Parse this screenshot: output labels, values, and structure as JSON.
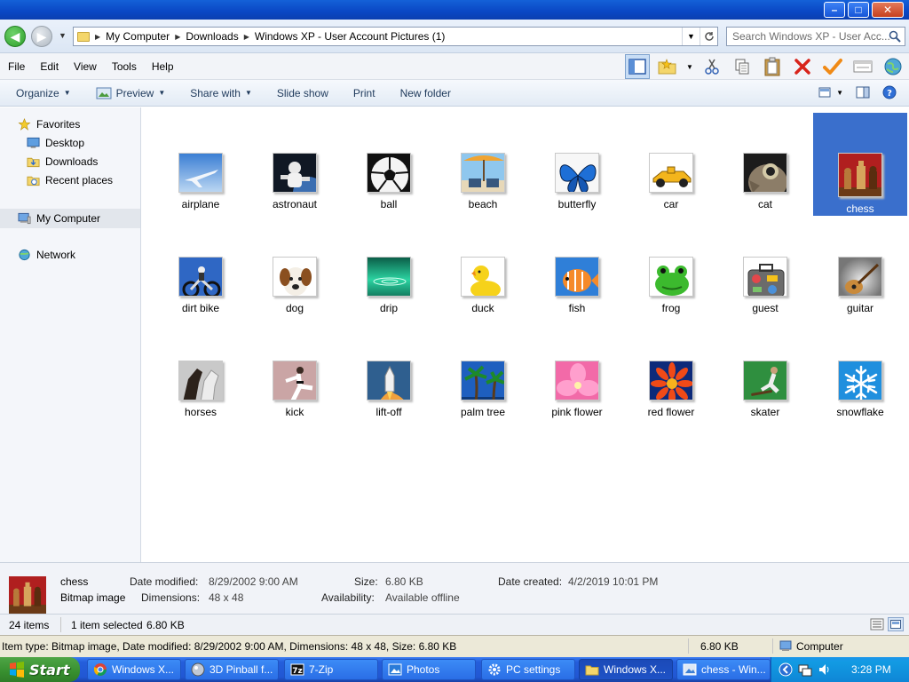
{
  "window": {
    "min": "–",
    "max": "□",
    "close": "✕"
  },
  "address": {
    "crumbs": [
      "My Computer",
      "Downloads",
      "Windows XP - User Account Pictures (1)"
    ],
    "search_placeholder": "Search Windows XP - User Acc..."
  },
  "menu": [
    "File",
    "Edit",
    "View",
    "Tools",
    "Help"
  ],
  "commands": {
    "organize": "Organize",
    "preview": "Preview",
    "share": "Share with",
    "slideshow": "Slide show",
    "print": "Print",
    "newfolder": "New folder"
  },
  "nav": {
    "favorites": "Favorites",
    "desktop": "Desktop",
    "downloads": "Downloads",
    "recent": "Recent places",
    "computer": "My Computer",
    "network": "Network"
  },
  "files": [
    {
      "name": "airplane"
    },
    {
      "name": "astronaut"
    },
    {
      "name": "ball"
    },
    {
      "name": "beach"
    },
    {
      "name": "butterfly"
    },
    {
      "name": "car"
    },
    {
      "name": "cat"
    },
    {
      "name": "chess"
    },
    {
      "name": "dirt bike"
    },
    {
      "name": "dog"
    },
    {
      "name": "drip"
    },
    {
      "name": "duck"
    },
    {
      "name": "fish"
    },
    {
      "name": "frog"
    },
    {
      "name": "guest"
    },
    {
      "name": "guitar"
    },
    {
      "name": "horses"
    },
    {
      "name": "kick"
    },
    {
      "name": "lift-off"
    },
    {
      "name": "palm tree"
    },
    {
      "name": "pink flower"
    },
    {
      "name": "red flower"
    },
    {
      "name": "skater"
    },
    {
      "name": "snowflake"
    }
  ],
  "selected_file": "chess",
  "details": {
    "name": "chess",
    "type": "Bitmap image",
    "date_modified_label": "Date modified:",
    "date_modified": "8/29/2002 9:00 AM",
    "dimensions_label": "Dimensions:",
    "dimensions": "48 x 48",
    "size_label": "Size:",
    "size": "6.80 KB",
    "availability_label": "Availability:",
    "availability": "Available offline",
    "date_created_label": "Date created:",
    "date_created": "4/2/2019 10:01 PM"
  },
  "status": {
    "items": "24 items",
    "selected": "1 item selected",
    "selected_size": "6.80 KB",
    "item_info": "Item type: Bitmap image, Date modified: 8/29/2002 9:00 AM, Dimensions: 48 x 48, Size: 6.80 KB",
    "size": "6.80 KB",
    "zone": "Computer"
  },
  "taskbar": {
    "start": "Start",
    "tasks": [
      "Windows X...",
      "3D Pinball f...",
      "7-Zip",
      "Photos",
      "PC settings",
      "Windows X...",
      "chess - Win..."
    ],
    "clock": "3:28 PM"
  }
}
